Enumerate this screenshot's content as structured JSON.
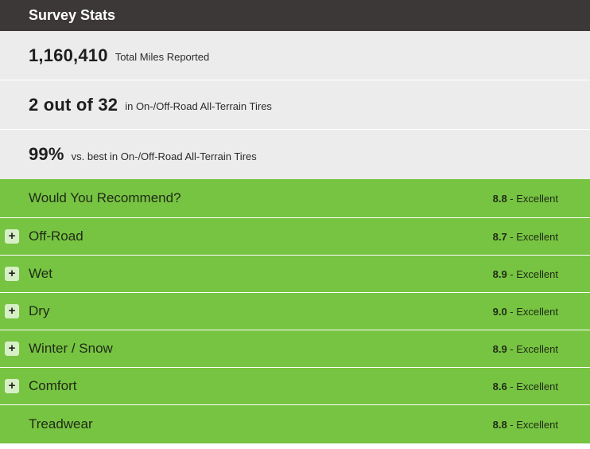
{
  "header": {
    "title": "Survey Stats"
  },
  "stats": [
    {
      "value": "1,160,410",
      "description": "Total Miles Reported"
    },
    {
      "value": "2 out of 32",
      "description": "in On-/Off-Road All-Terrain Tires"
    },
    {
      "value": "99%",
      "description": "vs. best in On-/Off-Road All-Terrain Tires"
    }
  ],
  "ratings": [
    {
      "label": "Would You Recommend?",
      "score": "8.8",
      "rating": " - Excellent",
      "expandable": false
    },
    {
      "label": "Off-Road",
      "score": "8.7",
      "rating": " - Excellent",
      "expandable": true
    },
    {
      "label": "Wet",
      "score": "8.9",
      "rating": " - Excellent",
      "expandable": true
    },
    {
      "label": "Dry",
      "score": "9.0",
      "rating": " - Excellent",
      "expandable": true
    },
    {
      "label": "Winter / Snow",
      "score": "8.9",
      "rating": " - Excellent",
      "expandable": true
    },
    {
      "label": "Comfort",
      "score": "8.6",
      "rating": " - Excellent",
      "expandable": true
    },
    {
      "label": "Treadwear",
      "score": "8.8",
      "rating": " - Excellent",
      "expandable": false
    }
  ],
  "expand_glyph": "+",
  "colors": {
    "header_bg": "#3b3837",
    "stat_bg": "#ececec",
    "rating_bg": "#77c442",
    "plus_bg": "#d7efc6"
  },
  "icons": {
    "expand": "plus-icon"
  }
}
